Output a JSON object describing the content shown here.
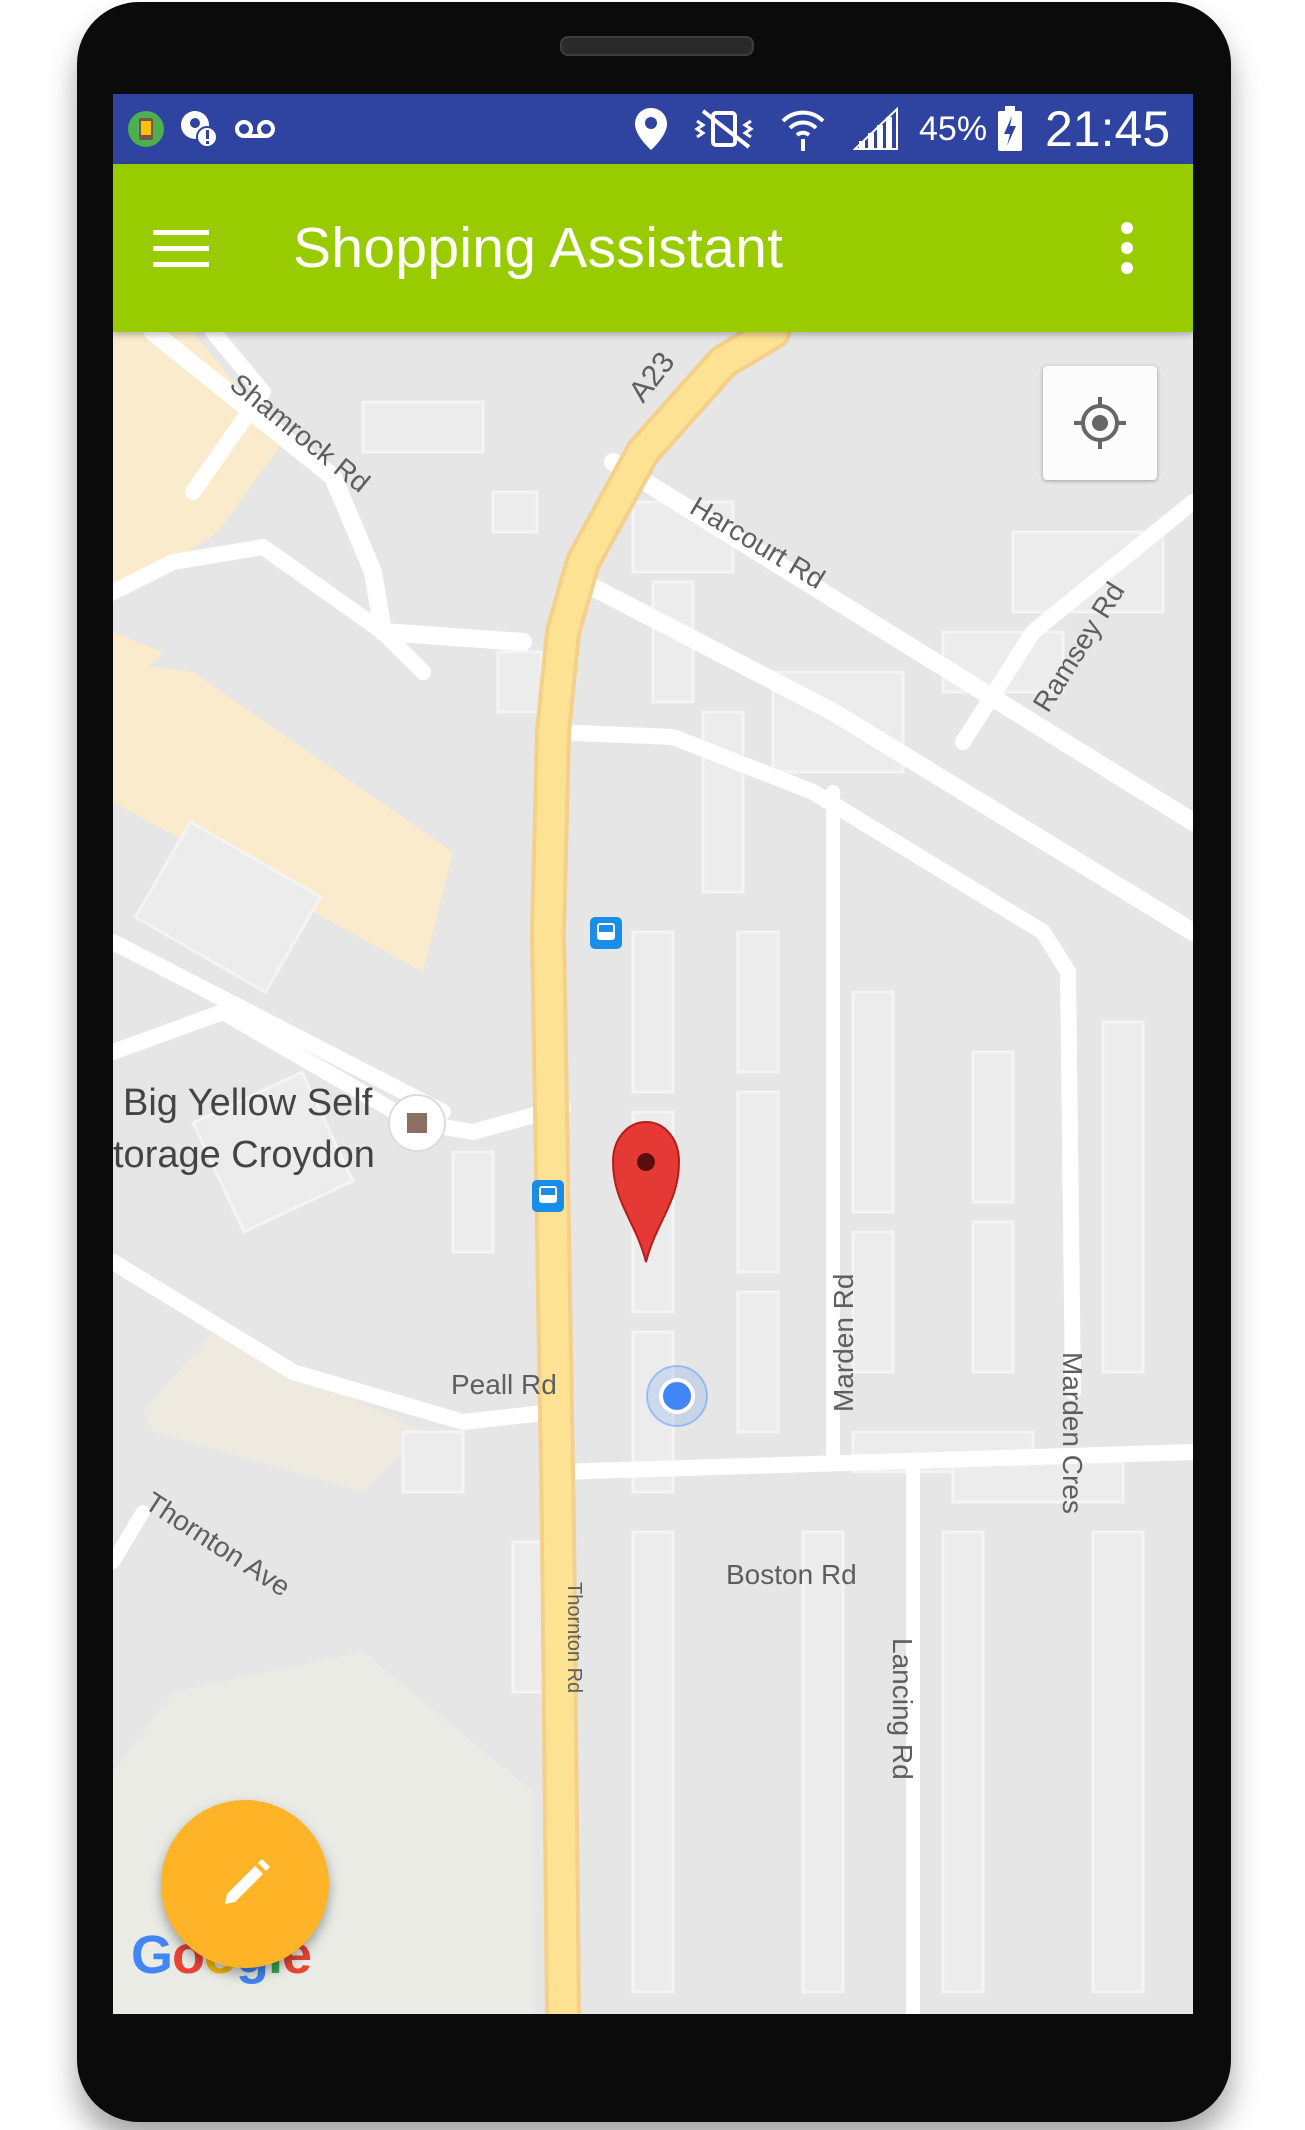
{
  "status_bar": {
    "left_icons": [
      "app-thumbnail-icon",
      "location-alert-icon",
      "voicemail-icon"
    ],
    "right_icons": [
      "location-pin-icon",
      "vibrate-icon",
      "wifi-icon",
      "signal-icon",
      "battery-charging-icon"
    ],
    "battery_percent": "45%",
    "time": "21:45"
  },
  "app_bar": {
    "title": "Shopping Assistant",
    "menu_icon": "hamburger-menu-icon",
    "overflow_icon": "more-vertical-icon"
  },
  "map": {
    "roads": {
      "a23": "A23",
      "shamrock": "Shamrock Rd",
      "harcourt": "Harcourt Rd",
      "ramsey": "Ramsey Rd",
      "peall": "Peall Rd",
      "marden_rd": "Marden Rd",
      "marden_cres": "Marden Cres",
      "thornton_ave": "Thornton Ave",
      "thornton_rd": "Thornton Rd",
      "boston": "Boston Rd",
      "lancing": "Lancing Rd"
    },
    "poi": {
      "line1": "Big Yellow Self",
      "line2": "torage Croydon"
    },
    "colors": {
      "background": "#e6e6e6",
      "road": "#ffffff",
      "main_road": "#fde293",
      "area": "#f9ebcb",
      "marker": "#e53935",
      "my_location": "#4285f4"
    },
    "my_location_button_icon": "my-location-icon",
    "attribution": "Google"
  },
  "fab": {
    "icon": "edit-pencil-icon",
    "color": "#ffb428"
  },
  "app_bar_color": "#99cc00",
  "status_bar_color": "#2f43a0"
}
